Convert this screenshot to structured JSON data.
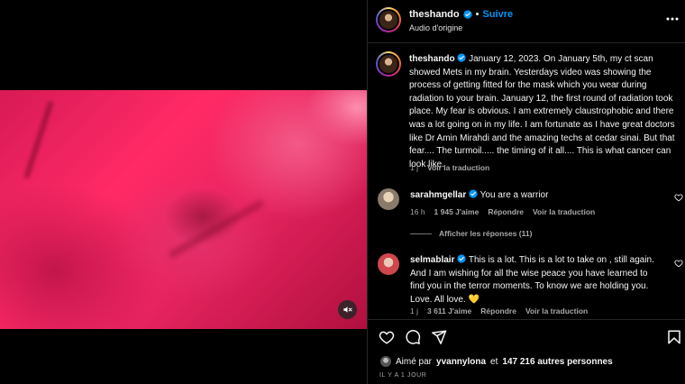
{
  "header": {
    "username": "theshando",
    "separator": "•",
    "follow_label": "Suivre",
    "audio_label": "Audio d'origine"
  },
  "caption": {
    "username": "theshando",
    "text": "January 12, 2023. On January 5th, my ct scan showed Mets in my brain. Yesterdays video was showing the process of getting fitted for the mask which you wear during radiation to your brain. January 12, the first round of radiation took place. My fear is obvious. I am extremely claustrophobic and there was a lot going on in my life. I am fortunate as I have great doctors like Dr Amin Mirahdi and the amazing techs at cedar sinai. But that fear.... The turmoil..... the timing of it all.... This is what cancer can look like.",
    "time": "1 j",
    "translate": "Voir la traduction"
  },
  "comments": [
    {
      "username": "sarahmgellar",
      "text": "You are a warrior",
      "time": "16 h",
      "likes": "1 945 J'aime",
      "reply": "Répondre",
      "translate": "Voir la traduction"
    },
    {
      "username": "selmablair",
      "text": "This is a lot. This is a lot to take on , still again. And I am wishing for all the wise peace you have learned to find you in the terror moments. To know we are holding you. Love. All love. 💛",
      "time": "1 j",
      "likes": "3 611 J'aime",
      "reply": "Répondre",
      "translate": "Voir la traduction"
    }
  ],
  "replies_label": "Afficher les réponses (11)",
  "likes": {
    "prefix": "Aimé par",
    "user": "yvannylona",
    "connector": "et",
    "others": "147 216 autres personnes"
  },
  "time_ago": "IL Y A 1 JOUR",
  "icons": [
    "verified-icon",
    "more-icon",
    "heart-icon",
    "comment-icon",
    "share-icon",
    "bookmark-icon",
    "sound-off-icon"
  ],
  "colors": {
    "accent": "#0095f6",
    "background": "#000000",
    "muted": "#a8a8a8",
    "media": "#e8245f"
  }
}
